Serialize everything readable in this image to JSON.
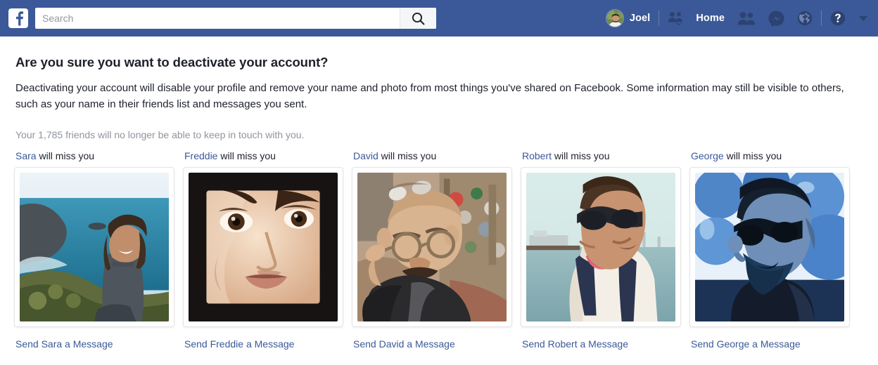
{
  "header": {
    "logo_icon": "facebook-f-icon",
    "search": {
      "value": "",
      "placeholder": "Search",
      "icon": "search-icon"
    },
    "user": {
      "name": "Joel",
      "avatar_icon": "user-avatar"
    },
    "find_friends_icon": "find-friends-icon",
    "home_label": "Home",
    "friend_requests_icon": "friend-requests-icon",
    "messenger_icon": "messenger-icon",
    "notifications_icon": "globe-notifications-icon",
    "help_icon": "help-question-icon",
    "account_menu_icon": "chevron-down-icon",
    "bar_color": "#3b5998",
    "icon_color": "#2c4270"
  },
  "main": {
    "title": "Are you sure you want to deactivate your account?",
    "description": "Deactivating your account will disable your profile and remove your name and photo from most things you've shared on Facebook. Some information may still be visible to others, such as your name in their friends list and messages you sent.",
    "friends_note": "Your 1,785 friends will no longer be able to keep in touch with you.",
    "friend_count": "1,785",
    "link_color": "#3b5998",
    "cards": [
      {
        "name": "Sara",
        "caption_suffix": " will miss you",
        "link": "Send Sara a Message",
        "photo_alt": "woman sitting on coastal cliff overlooking ocean"
      },
      {
        "name": "Freddie",
        "caption_suffix": " will miss you",
        "link": "Send Freddie a Message",
        "photo_alt": "close-up portrait of a face on black background"
      },
      {
        "name": "David",
        "caption_suffix": " will miss you",
        "link": "Send David a Message",
        "photo_alt": "bald man with mustache adjusting glasses at a market"
      },
      {
        "name": "Robert",
        "caption_suffix": " will miss you",
        "link": "Send Robert a Message",
        "photo_alt": "young man in sunglasses with pink bow tie by the water"
      },
      {
        "name": "George",
        "caption_suffix": " will miss you",
        "link": "Send George a Message",
        "photo_alt": "bearded man in sunglasses with blue balloons"
      }
    ]
  }
}
